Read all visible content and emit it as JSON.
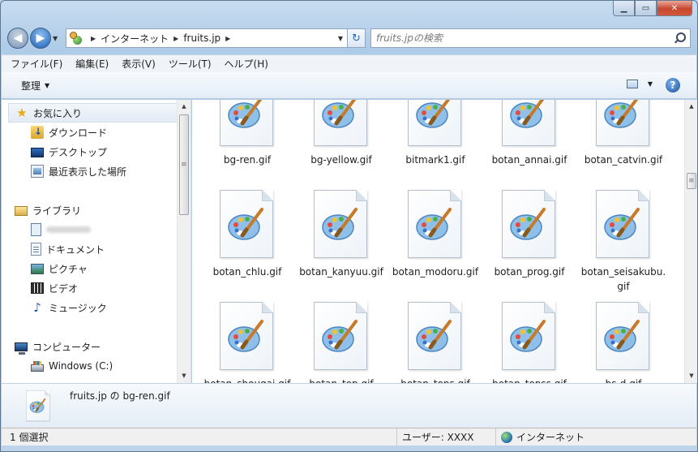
{
  "titlebar": {
    "minimize_glyph": "▁",
    "maximize_glyph": "▭",
    "close_glyph": "✕"
  },
  "address": {
    "back_glyph": "◀",
    "forward_glyph": "▶",
    "breadcrumb": [
      "インターネット",
      "fruits.jp"
    ],
    "separator_glyph": "▶",
    "dropdown_glyph": "▼",
    "refresh_glyph": "↻"
  },
  "search": {
    "placeholder": "fruits.jpの検索"
  },
  "menu": {
    "items": [
      "ファイル(F)",
      "編集(E)",
      "表示(V)",
      "ツール(T)",
      "ヘルプ(H)"
    ]
  },
  "command_bar": {
    "organize_label": "整理",
    "arrow_glyph": "▼",
    "help_glyph": "?"
  },
  "nav": {
    "favorites": {
      "label": "お気に入り",
      "items": [
        "ダウンロード",
        "デスクトップ",
        "最近表示した場所"
      ]
    },
    "libraries": {
      "label": "ライブラリ",
      "items": [
        "ドキュメント",
        "ピクチャ",
        "ビデオ",
        "ミュージック"
      ]
    },
    "computer": {
      "label": "コンピューター",
      "items": [
        "Windows (C:)"
      ]
    },
    "scroll_up_glyph": "▲",
    "scroll_down_glyph": "▼"
  },
  "files": [
    "bg-ren.gif",
    "bg-yellow.gif",
    "bitmark1.gif",
    "botan_annai.gif",
    "botan_catvin.gif",
    "botan_chlu.gif",
    "botan_kanyuu.gif",
    "botan_modoru.gif",
    "botan_prog.gif",
    "botan_seisakubu.gif",
    "botan_shougai.gif",
    "botan_top.gif",
    "botan_tops.gif",
    "botan_topss.gif",
    "bs-d.gif"
  ],
  "details": {
    "title": "fruits.jp の bg-ren.gif"
  },
  "status": {
    "selection": "1 個選択",
    "user": "ユーザー:  XXXX",
    "zone": "インターネット"
  },
  "colors": {
    "palette_brush": "#c77a28",
    "palette_board": "#8fc0ea",
    "window_frame": "#bcd3ea"
  }
}
